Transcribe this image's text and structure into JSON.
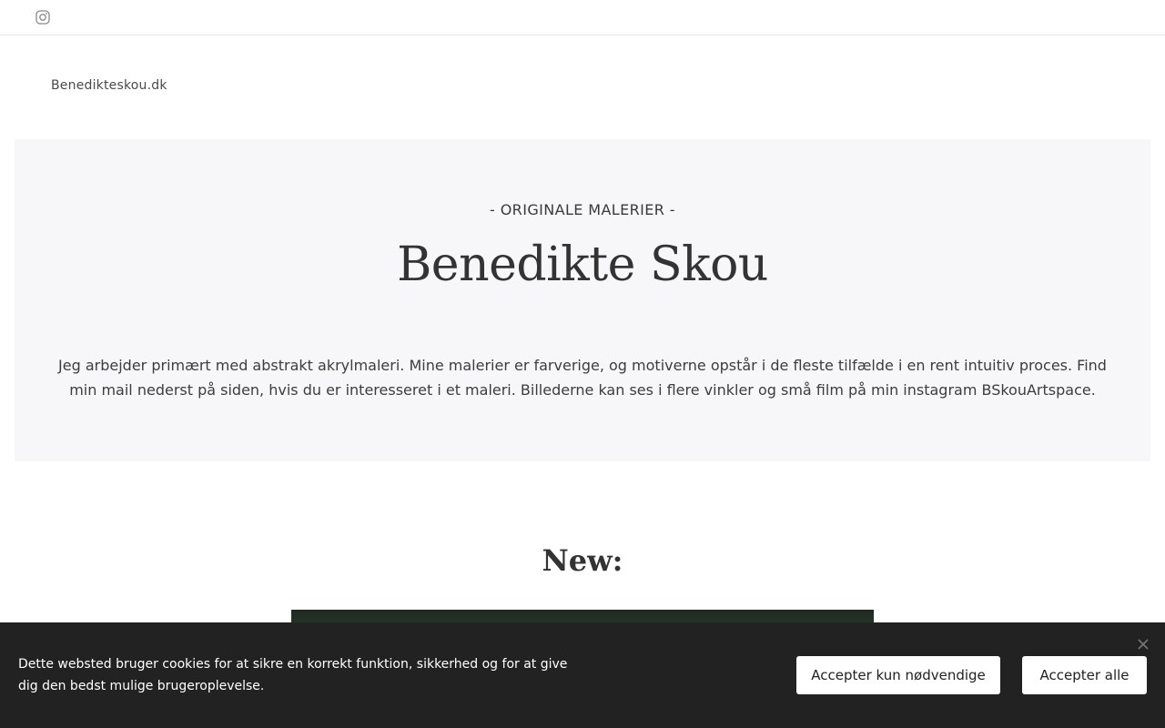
{
  "topbar": {
    "social_icon": "instagram-icon"
  },
  "site": {
    "name": "Benedikteskou.dk"
  },
  "hero": {
    "kicker": "- ORIGINALE MALERIER -",
    "title": "Benedikte Skou",
    "description": "Jeg arbejder primært med abstrakt akrylmaleri. Mine malerier er farverige, og motiverne opstår i de fleste tilfælde i en rent intuitiv proces. Find min mail nederst på siden, hvis du er interesseret i et maleri. Billederne kan ses i flere vinkler og små film på min instagram BSkouArtspace."
  },
  "section": {
    "title": "New:"
  },
  "cookie_banner": {
    "message": "Dette websted bruger cookies for at sikre en korrekt funktion, sikkerhed og for at give dig den bedst mulige brugeroplevelse.",
    "accept_necessary_label": "Accepter kun nødvendige",
    "accept_all_label": "Accepter alle",
    "close_icon": "close-icon"
  },
  "colors": {
    "hero_background": "#f7f6f8",
    "cookie_background": "#222222",
    "text": "#333333"
  }
}
